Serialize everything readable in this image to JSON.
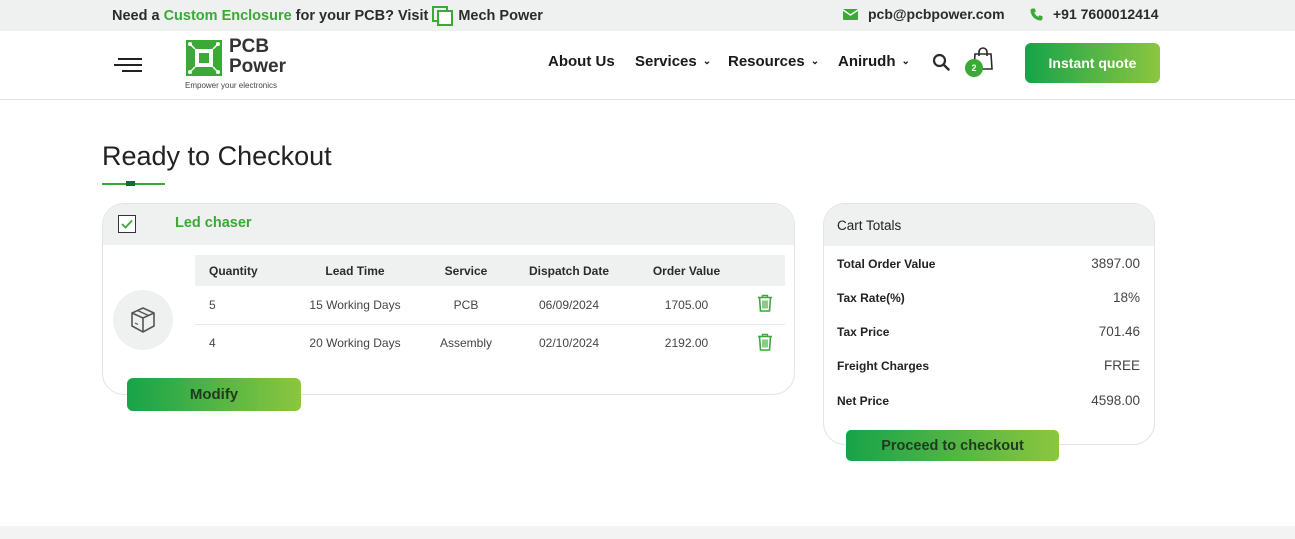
{
  "topbar": {
    "promo_prefix": "Need a",
    "promo_highlight": "Custom Enclosure",
    "promo_mid": "for your PCB? Visit",
    "promo_brand": "Mech Power",
    "email": "pcb@pcbpower.com",
    "phone": "+91 7600012414"
  },
  "header": {
    "logo_line1": "PCB",
    "logo_line2": "Power",
    "logo_tagline": "Empower your electronics",
    "nav": [
      {
        "label": "About Us"
      },
      {
        "label": "Services"
      },
      {
        "label": "Resources"
      },
      {
        "label": "Anirudh"
      }
    ],
    "cart_count": "2",
    "quote_label": "Instant quote"
  },
  "page": {
    "title": "Ready to Checkout"
  },
  "product": {
    "name": "Led chaser",
    "columns": [
      "Quantity",
      "Lead Time",
      "Service",
      "Dispatch Date",
      "Order Value"
    ],
    "rows": [
      {
        "quantity": "5",
        "lead_time": "15 Working Days",
        "service": "PCB",
        "dispatch_date": "06/09/2024",
        "order_value": "1705.00"
      },
      {
        "quantity": "4",
        "lead_time": "20 Working Days",
        "service": "Assembly",
        "dispatch_date": "02/10/2024",
        "order_value": "2192.00"
      }
    ],
    "modify_label": "Modify"
  },
  "totals": {
    "title": "Cart Totals",
    "rows": [
      {
        "label": "Total Order Value",
        "value": "3897.00"
      },
      {
        "label": "Tax Rate(%)",
        "value": "18%"
      },
      {
        "label": "Tax Price",
        "value": "701.46"
      },
      {
        "label": "Freight Charges",
        "value": "FREE"
      },
      {
        "label": "Net Price",
        "value": "4598.00"
      }
    ],
    "proceed_label": "Proceed to checkout"
  },
  "colors": {
    "brand_green": "#3aa935",
    "gradient_start": "#17a34a",
    "gradient_end": "#8cc63f",
    "panel_bg": "#eff0f0"
  }
}
